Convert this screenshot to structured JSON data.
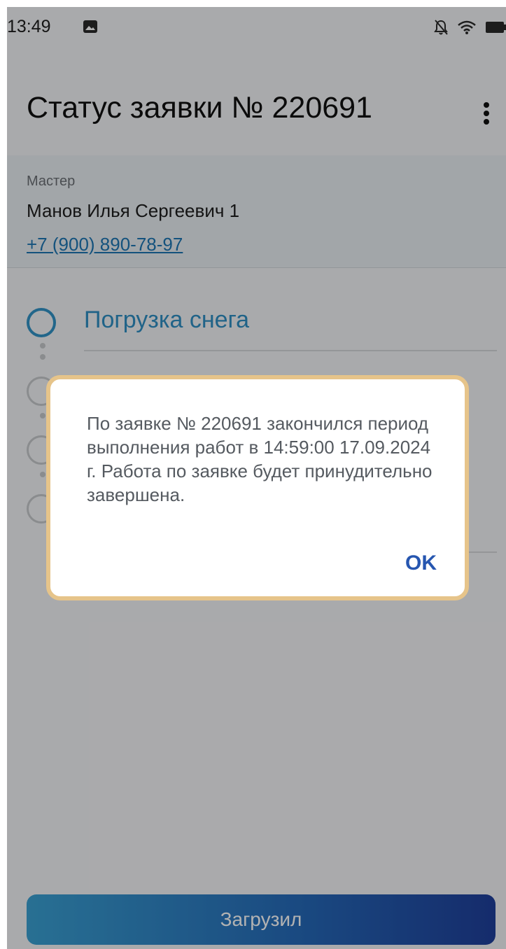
{
  "status_bar": {
    "time": "13:49",
    "icons": [
      "image-notification-icon",
      "bell-off-icon",
      "wifi-icon",
      "battery-icon"
    ]
  },
  "header": {
    "title": "Статус заявки № 220691",
    "more_icon": "more-vertical-icon"
  },
  "master": {
    "label": "Мастер",
    "name": "Манов Илья Сергеевич 1",
    "phone": "+7 (900) 890-78-97"
  },
  "steps": [
    {
      "title": "Погрузка снега",
      "state": "active"
    }
  ],
  "dialog": {
    "message": "По заявке № 220691 закончился период выполнения работ в 14:59:00 17.09.2024 г. Работа по заявке будет принудительно завершена.",
    "ok_label": "OK"
  },
  "primary_button": {
    "label": "Загрузил"
  },
  "colors": {
    "accent": "#2e8fc3",
    "button_gradient_start": "#3aa1d3",
    "button_gradient_end": "#1f3f9b",
    "dialog_highlight_border": "#e6c48a",
    "link": "#1d76b3"
  }
}
